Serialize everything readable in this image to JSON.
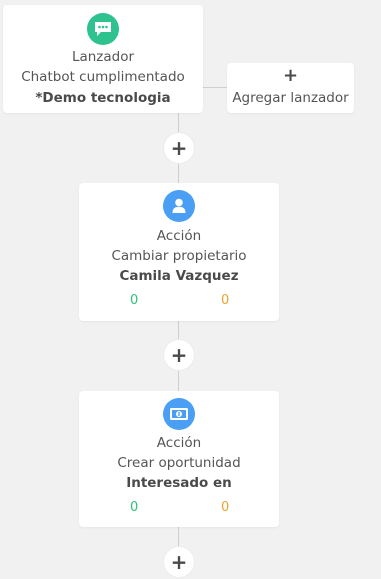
{
  "trigger": {
    "type": "Lanzador",
    "title": "Chatbot cumplimentado",
    "subtitle": "*Demo tecnologia"
  },
  "add_trigger": {
    "icon": "+",
    "label": "Agregar lanzador"
  },
  "add_step_icon": "+",
  "actions": [
    {
      "type": "Acción",
      "title": "Cambiar propietario",
      "subtitle": "Camila Vazquez",
      "count_left": "0",
      "count_right": "0"
    },
    {
      "type": "Acción",
      "title": "Crear oportunidad",
      "subtitle": "Interesado en",
      "count_left": "0",
      "count_right": "0"
    }
  ],
  "colors": {
    "chat_icon_bg": "#2ec28f",
    "action_icon_bg": "#4a9ff5",
    "count_left": "#2ec27e",
    "count_right": "#f0a030"
  },
  "icons": {
    "trigger": "chat-bubble-icon",
    "action_1": "user-icon",
    "action_2": "money-icon"
  }
}
